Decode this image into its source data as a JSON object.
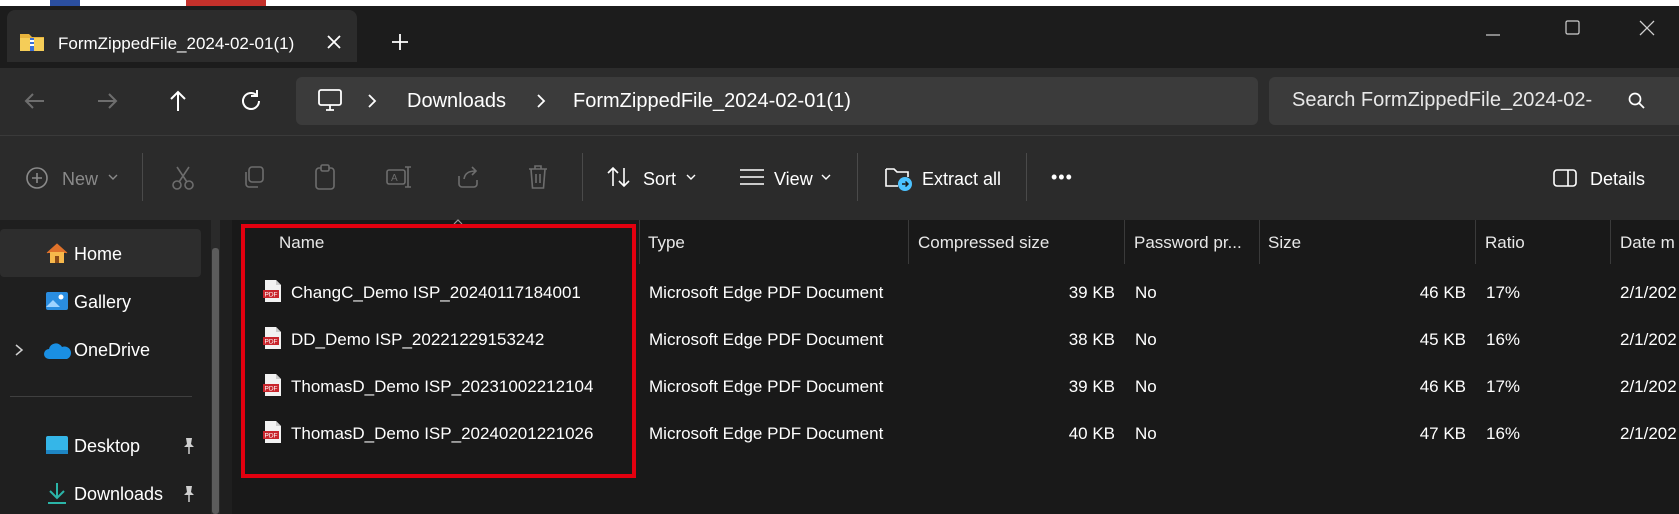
{
  "tab": {
    "title": "FormZippedFile_2024-02-01(1)"
  },
  "address": {
    "crumbs": [
      "Downloads",
      "FormZippedFile_2024-02-01(1)"
    ]
  },
  "search": {
    "placeholder": "Search FormZippedFile_2024-02-"
  },
  "toolbar": {
    "new_label": "New",
    "sort_label": "Sort",
    "view_label": "View",
    "extract_label": "Extract all",
    "more_label": "•••",
    "details_label": "Details"
  },
  "nav": {
    "home": "Home",
    "gallery": "Gallery",
    "onedrive": "OneDrive",
    "desktop": "Desktop",
    "downloads": "Downloads"
  },
  "columns": {
    "name": "Name",
    "type": "Type",
    "compressed": "Compressed size",
    "password": "Password pr...",
    "size": "Size",
    "ratio": "Ratio",
    "date": "Date m"
  },
  "files": [
    {
      "name": "ChangC_Demo ISP_20240117184001",
      "type": "Microsoft Edge PDF Document",
      "compressed": "39 KB",
      "password": "No",
      "size": "46 KB",
      "ratio": "17%",
      "date": "2/1/202"
    },
    {
      "name": "DD_Demo ISP_20221229153242",
      "type": "Microsoft Edge PDF Document",
      "compressed": "38 KB",
      "password": "No",
      "size": "45 KB",
      "ratio": "16%",
      "date": "2/1/202"
    },
    {
      "name": "ThomasD_Demo ISP_20231002212104",
      "type": "Microsoft Edge PDF Document",
      "compressed": "39 KB",
      "password": "No",
      "size": "46 KB",
      "ratio": "17%",
      "date": "2/1/202"
    },
    {
      "name": "ThomasD_Demo ISP_20240201221026",
      "type": "Microsoft Edge PDF Document",
      "compressed": "40 KB",
      "password": "No",
      "size": "47 KB",
      "ratio": "16%",
      "date": "2/1/202"
    }
  ],
  "icons": {
    "pdf_badge": "PDF"
  },
  "colors": {
    "highlight": "#e3000f",
    "accent": "#4cc2ff"
  }
}
